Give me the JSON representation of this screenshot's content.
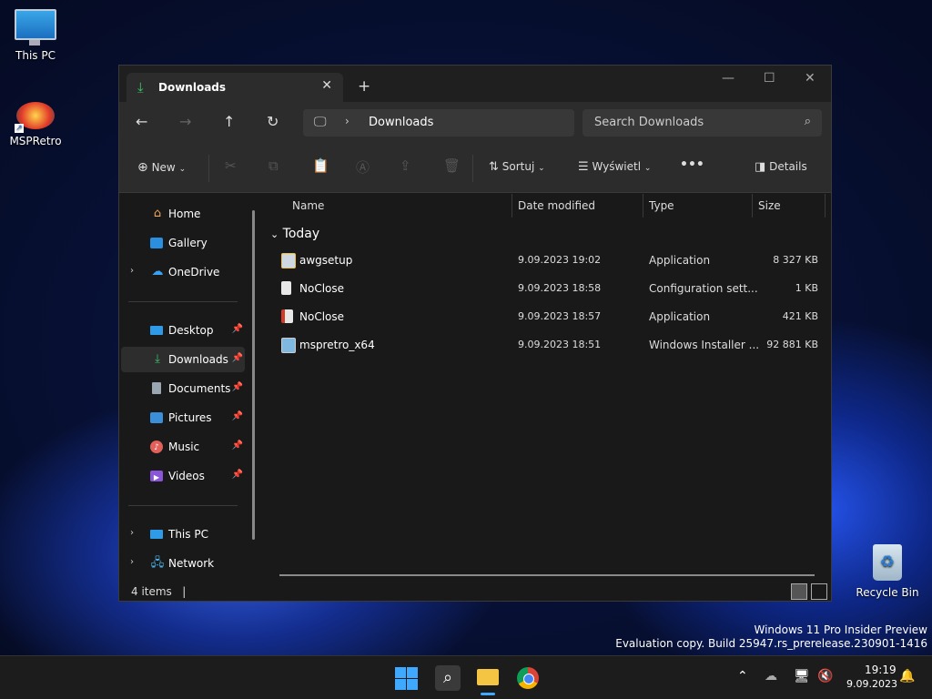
{
  "desktop": {
    "icons": [
      {
        "label": "This PC"
      },
      {
        "label": "MSPRetro"
      },
      {
        "label": "Recycle Bin"
      }
    ],
    "watermark": {
      "line1": "Windows 11 Pro Insider Preview",
      "line2": "Evaluation copy. Build 25947.rs_prerelease.230901-1416"
    }
  },
  "window": {
    "tab_title": "Downloads",
    "address_crumb": "Downloads",
    "search_placeholder": "Search Downloads"
  },
  "toolbar": {
    "new_label": "New",
    "sort_label": "Sortuj",
    "view_label": "Wyświetl",
    "more_label": "•••",
    "details_label": "Details"
  },
  "sidebar": {
    "items": [
      {
        "label": "Home"
      },
      {
        "label": "Gallery"
      },
      {
        "label": "OneDrive"
      },
      {
        "label": "Desktop"
      },
      {
        "label": "Downloads"
      },
      {
        "label": "Documents"
      },
      {
        "label": "Pictures"
      },
      {
        "label": "Music"
      },
      {
        "label": "Videos"
      },
      {
        "label": "This PC"
      },
      {
        "label": "Network"
      }
    ]
  },
  "columns": {
    "name": "Name",
    "date": "Date modified",
    "type": "Type",
    "size": "Size"
  },
  "group": {
    "label": "Today"
  },
  "files": [
    {
      "name": "awgsetup",
      "date": "9.09.2023 19:02",
      "type": "Application",
      "size": "8 327 KB"
    },
    {
      "name": "NoClose",
      "date": "9.09.2023 18:58",
      "type": "Configuration sett...",
      "size": "1 KB"
    },
    {
      "name": "NoClose",
      "date": "9.09.2023 18:57",
      "type": "Application",
      "size": "421 KB"
    },
    {
      "name": "mspretro_x64",
      "date": "9.09.2023 18:51",
      "type": "Windows Installer ...",
      "size": "92 881 KB"
    }
  ],
  "status": {
    "item_count": "4 items"
  },
  "taskbar": {
    "time": "19:19",
    "date": "9.09.2023"
  },
  "colors": {
    "accent": "#3fa9ff",
    "downloads_green": "#3cc46a"
  }
}
